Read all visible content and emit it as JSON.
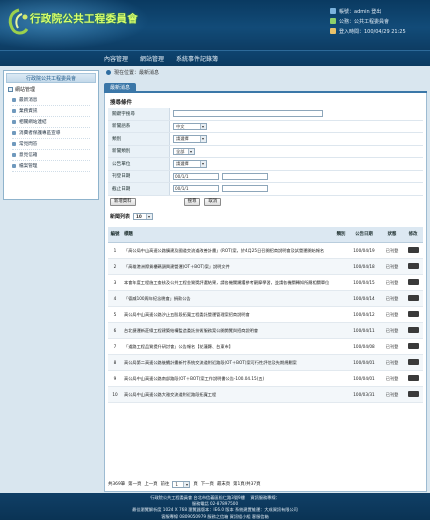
{
  "header": {
    "site_title": "行政院公共工程委員會",
    "user_label": "帳號：admin 登出",
    "unit_label": "公務：公共工程委員會",
    "login_label": "登入時間：100/04/29 21:25"
  },
  "nav": {
    "items": [
      "內容管理",
      "網站管理",
      "系統事件記錄簿"
    ]
  },
  "sidebar": {
    "head": "行政院公共工程委員會",
    "group": "網站管理",
    "items": [
      "最新消息",
      "業務資訊",
      "相關網站連結",
      "消費者保護專區宣導",
      "常見問答",
      "意見信箱",
      "檔案管理"
    ]
  },
  "breadcrumb": "現在位置：最新消息",
  "tab": "最新消息",
  "form": {
    "section_title": "搜尋條件",
    "keyword_label": "關鍵字搜尋",
    "language_label": "新聞語系",
    "language_value": "中文",
    "category_label": "類別",
    "category_value": "請選擇",
    "news_category_label": "新聞類別",
    "news_category_value": "全部",
    "unit_label": "公告單位",
    "unit_value": "請選擇",
    "publish_date_label": "刊登日期",
    "publish_date_value": "00/1/1",
    "expire_date_label": "截止日期",
    "expire_date_value": "00/1/1",
    "add_button": "新增資料",
    "search_button": "搜尋",
    "cancel_button": "取消"
  },
  "list": {
    "title": "新聞列表",
    "page_size": "10",
    "columns": [
      "編號",
      "標題",
      "類別",
      "公告日期",
      "狀態",
      "修改"
    ],
    "rows": [
      {
        "no": "1",
        "title": "「高公局中山高速公路擴建及國道交流道改善計畫」(ROT)案，於4月25日召開招商說明會及試營運開始報名",
        "category": "",
        "date": "100/04/19",
        "status": "已刊登"
      },
      {
        "no": "2",
        "title": "「高雄港洲際貨櫃碼頭興建營運(OT＋BOT)案」說明文件",
        "category": "",
        "date": "100/04/18",
        "status": "已刊登"
      },
      {
        "no": "3",
        "title": "本會年度工程施工查核及公共工程金質獎評選結果，請各機關踴躍參考觀摩學習，並請各機關轉知所屬相關單位",
        "category": "",
        "date": "100/04/15",
        "status": "已刊登"
      },
      {
        "no": "4",
        "title": "「德威100周年紀念晚會」捐款公告",
        "category": "",
        "date": "100/04/14",
        "status": "已刊登"
      },
      {
        "no": "5",
        "title": "高公局中山高速公路汐止五股段拓寬工程委託營運管理案招商說明會",
        "category": "",
        "date": "100/04/12",
        "status": "已刊登"
      },
      {
        "no": "6",
        "title": "台北捷運新莊線工程建築結構監造委託技術服務案公開閱覽與招商說明會",
        "category": "",
        "date": "100/04/11",
        "status": "已刊登"
      },
      {
        "no": "7",
        "title": "「道路工程品質提升研討會」公告報名【花蓮縣、台東市】",
        "category": "",
        "date": "100/04/08",
        "status": "已刊登"
      },
      {
        "no": "8",
        "title": "高公局第二高速公路後續計畫新竹系統交流道附近路段(OT＋BOT)案可行性評估及先期規劃案",
        "category": "",
        "date": "100/04/01",
        "status": "已刊登"
      },
      {
        "no": "9",
        "title": "高公局中山高速公路南部路段(OT＋BOT)案工作說明書公告-100.04.15(五)",
        "category": "",
        "date": "100/04/01",
        "status": "已刊登"
      },
      {
        "no": "10",
        "title": "高公局中山高速公路大雅交流道附近路段拓寬工程",
        "category": "",
        "date": "100/03/31",
        "status": "已刊登"
      }
    ],
    "pager": {
      "total": "共369筆",
      "first": "第一頁",
      "prev": "上一頁",
      "goto_prefix": "前往",
      "page": "1",
      "goto_suffix": "頁",
      "next": "下一頁",
      "last": "最末頁",
      "pages": "第1頁/共37頁"
    }
  },
  "footer": {
    "line1": "行政院公共工程委員會 台北市信義區松仁路3號9樓 　資訊服務專線：",
    "line2": "服務電話 02-87897500",
    "line3": "最佳瀏覽解析度 1024 X 768 瀏覽器版本：IE6.0 版本 系統建置維運：大成資訊有限公司",
    "line4": "客服專線 0809050979 服務之信箱 資訊組小組 客服信箱"
  },
  "colors": {
    "header": "#0a3a61",
    "title_green": "#d8ff6a",
    "accent_blue": "#3b77a8"
  }
}
